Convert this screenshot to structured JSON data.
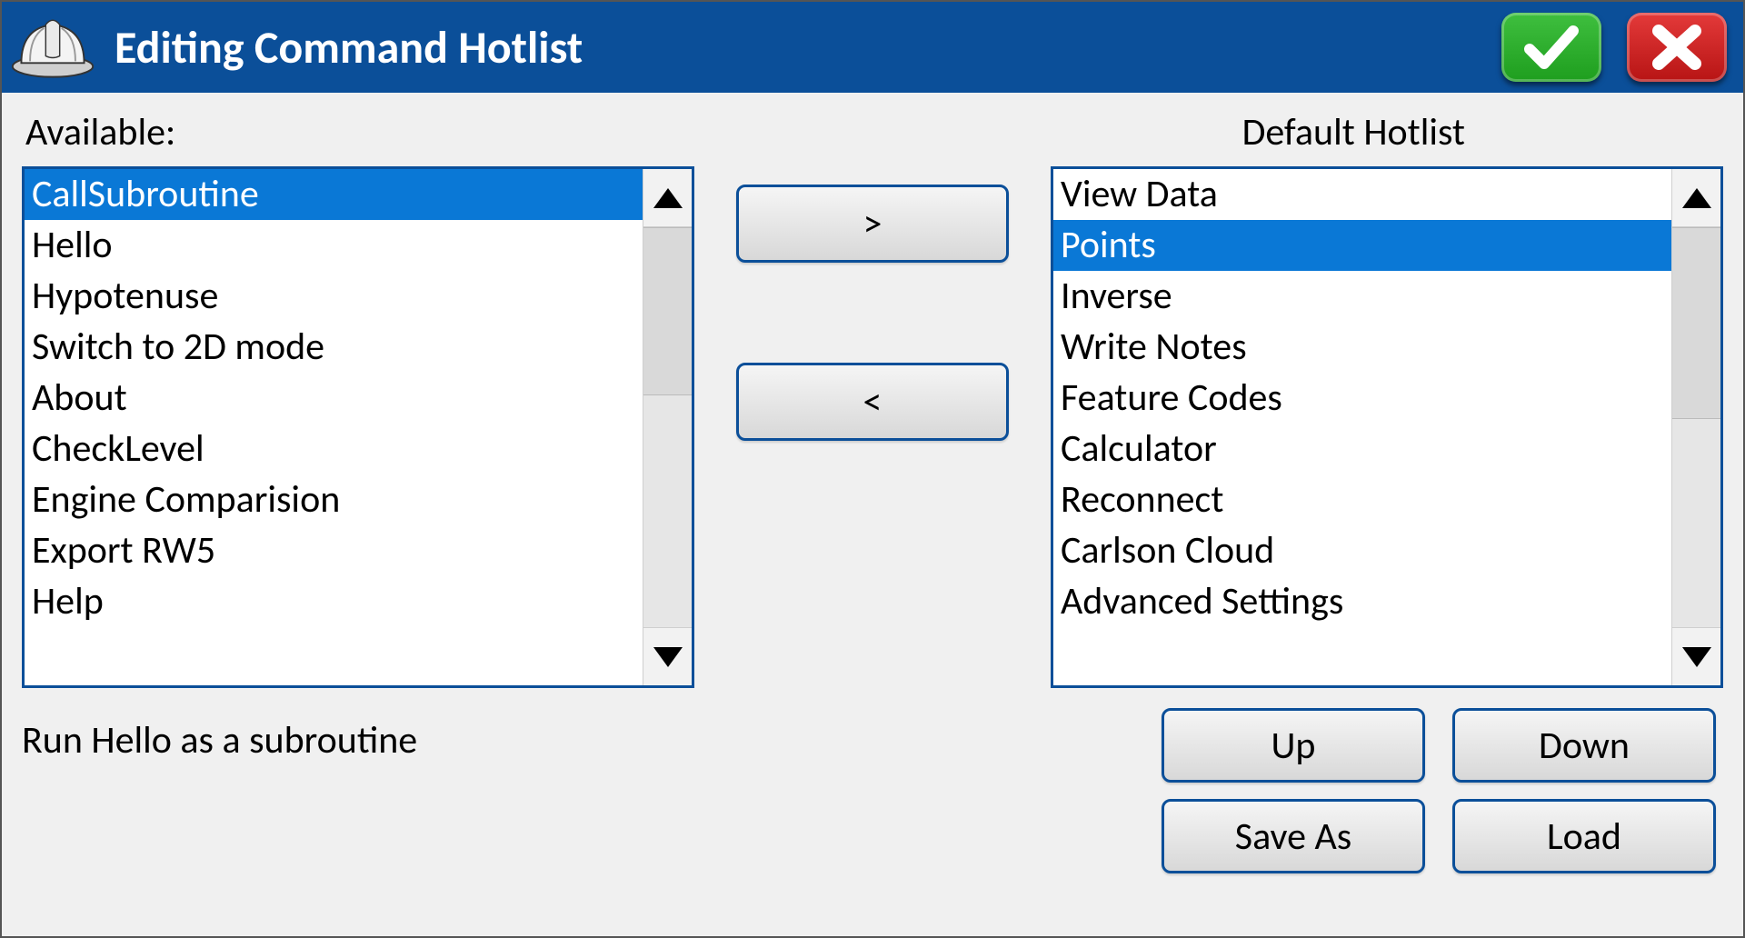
{
  "header": {
    "title": "Editing Command Hotlist"
  },
  "labels": {
    "available": "Available:",
    "hotlist": "Default Hotlist"
  },
  "available_list": {
    "selected_index": 0,
    "items": [
      "CallSubroutine",
      "Hello",
      "Hypotenuse",
      "Switch to 2D mode",
      "About",
      "CheckLevel",
      "Engine Comparision",
      "Export RW5",
      "Help"
    ]
  },
  "hotlist_list": {
    "selected_index": 1,
    "items": [
      "View Data",
      "Points",
      "Inverse",
      "Write Notes",
      "Feature Codes",
      "Calculator",
      "Reconnect",
      "Carlson Cloud",
      "Advanced Settings"
    ]
  },
  "buttons": {
    "add": ">",
    "remove": "<",
    "up": "Up",
    "down": "Down",
    "save_as": "Save As",
    "load": "Load"
  },
  "description": "Run Hello as a subroutine"
}
